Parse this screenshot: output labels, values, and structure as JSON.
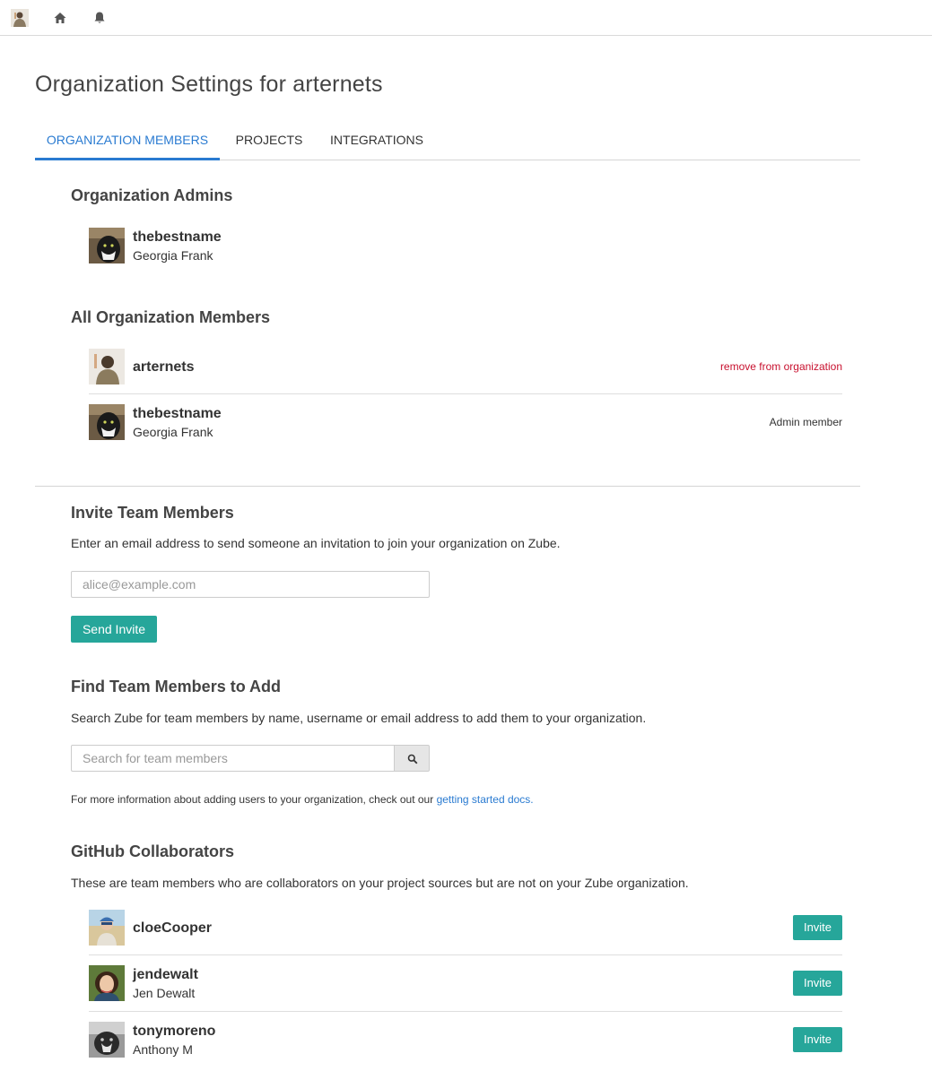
{
  "nav": {
    "icons": [
      "user-avatar",
      "home-icon",
      "bell-icon"
    ]
  },
  "page": {
    "title": "Organization Settings for arternets"
  },
  "tabs": [
    {
      "label": "ORGANIZATION MEMBERS",
      "active": true
    },
    {
      "label": "PROJECTS",
      "active": false
    },
    {
      "label": "INTEGRATIONS",
      "active": false
    }
  ],
  "admins": {
    "title": "Organization Admins",
    "members": [
      {
        "username": "thebestname",
        "name": "Georgia Frank"
      }
    ]
  },
  "all_members": {
    "title": "All Organization Members",
    "members": [
      {
        "username": "arternets",
        "name": "",
        "action": "remove from organization"
      },
      {
        "username": "thebestname",
        "name": "Georgia Frank",
        "action": "Admin member"
      }
    ]
  },
  "invite": {
    "title": "Invite Team Members",
    "description": "Enter an email address to send someone an invitation to join your organization on Zube.",
    "email_placeholder": "alice@example.com",
    "email_value": "",
    "button_label": "Send Invite"
  },
  "find": {
    "title": "Find Team Members to Add",
    "description": "Search Zube for team members by name, username or email address to add them to your organization.",
    "search_placeholder": "Search for team members",
    "search_value": "",
    "note_prefix": "For more information about adding users to your organization, check out our ",
    "note_link": "getting started docs."
  },
  "github": {
    "title": "GitHub Collaborators",
    "description": "These are team members who are collaborators on your project sources but are not on your Zube organization.",
    "collaborators": [
      {
        "username": "cloeCooper",
        "name": "",
        "button_label": "Invite"
      },
      {
        "username": "jendewalt",
        "name": "Jen Dewalt",
        "button_label": "Invite"
      },
      {
        "username": "tonymoreno",
        "name": "Anthony M",
        "button_label": "Invite"
      }
    ]
  },
  "colors": {
    "accent_blue": "#2a7bd1",
    "primary_button": "#26a69a",
    "danger_text": "#c8102e"
  }
}
